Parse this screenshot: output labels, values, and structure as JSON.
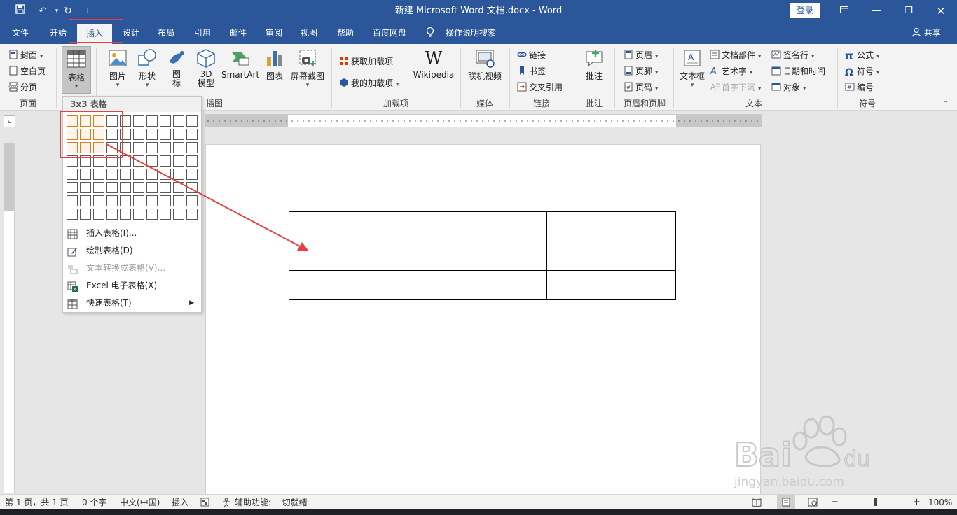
{
  "window": {
    "title": "新建 Microsoft Word 文档.docx  -  Word",
    "login": "登录",
    "share": "共享"
  },
  "tabs": [
    {
      "label": "文件"
    },
    {
      "label": "开始"
    },
    {
      "label": "插入"
    },
    {
      "label": "设计"
    },
    {
      "label": "布局"
    },
    {
      "label": "引用"
    },
    {
      "label": "邮件"
    },
    {
      "label": "审阅"
    },
    {
      "label": "视图"
    },
    {
      "label": "帮助"
    },
    {
      "label": "百度网盘"
    }
  ],
  "tell_me": "操作说明搜索",
  "ribbon": {
    "pages": {
      "cover": "封面",
      "blank": "空白页",
      "break": "分页",
      "label": "页面"
    },
    "table": {
      "label": "表格"
    },
    "illustrations": {
      "picture": "图片",
      "shapes": "形状",
      "icons_1": "图",
      "icons_2": "标",
      "model_1": "3D",
      "model_2": "模型",
      "smartart": "SmartArt",
      "chart": "图表",
      "screenshot": "屏幕截图",
      "label": "插图"
    },
    "addins": {
      "get": "获取加载项",
      "my": "我的加载项",
      "wikipedia": "Wikipedia",
      "label": "加载项"
    },
    "media": {
      "video": "联机视频",
      "label": "媒体"
    },
    "links": {
      "link": "链接",
      "bookmark": "书签",
      "crossref": "交叉引用",
      "label": "链接"
    },
    "comments": {
      "comment": "批注",
      "label": "批注"
    },
    "header_footer": {
      "header": "页眉",
      "footer": "页脚",
      "page_number": "页码",
      "label": "页眉和页脚"
    },
    "text": {
      "textbox": "文本框",
      "quickparts": "文档部件",
      "wordart": "艺术字",
      "dropcap": "首字下沉",
      "signature": "签名行",
      "datetime": "日期和时间",
      "object": "对象",
      "label": "文本"
    },
    "symbols": {
      "equation": "公式",
      "symbol": "符号",
      "number": "编号",
      "label": "符号"
    }
  },
  "table_dropdown": {
    "header": "3x3 表格",
    "rows": 8,
    "cols": 10,
    "selected_rows": 3,
    "selected_cols": 3,
    "items": [
      {
        "label": "插入表格(I)...",
        "enabled": true
      },
      {
        "label": "绘制表格(D)",
        "enabled": true
      },
      {
        "label": "文本转换成表格(V)...",
        "enabled": false
      },
      {
        "label": "Excel 电子表格(X)",
        "enabled": true
      },
      {
        "label": "快速表格(T)",
        "enabled": true
      }
    ]
  },
  "document": {
    "table_rows": 3,
    "table_cols": 3
  },
  "status": {
    "page": "第 1 页，共 1 页",
    "words": "0 个字",
    "language": "中文(中国)",
    "mode": "插入",
    "accessibility": "辅助功能: 一切就绪",
    "zoom": "100%",
    "zoom_minus": "−",
    "zoom_plus": "+"
  },
  "colors": {
    "accent": "#2b579a",
    "highlight": "#e84040",
    "selection": "#e07a1f"
  }
}
